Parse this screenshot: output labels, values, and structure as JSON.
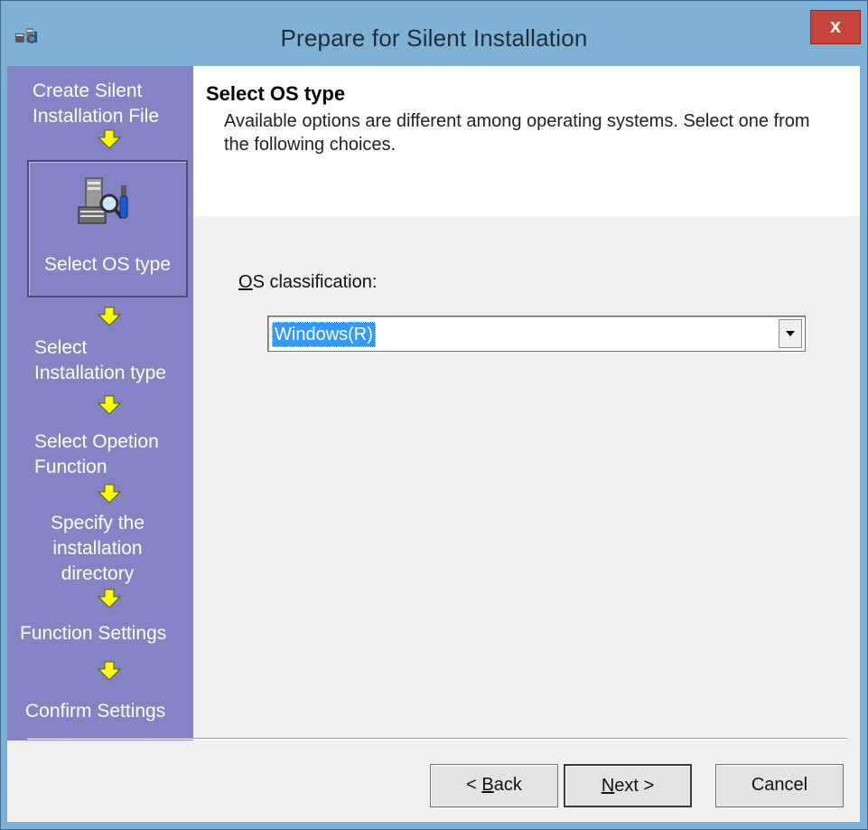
{
  "window": {
    "title": "Prepare for Silent Installation",
    "close_label": "x",
    "app_icon": "installer-icon"
  },
  "sidebar": {
    "steps": [
      {
        "label_lines": [
          "Create Silent",
          "Installation File"
        ],
        "state": "done"
      },
      {
        "label": "Select OS type",
        "state": "current",
        "icon": "server-inspect-icon"
      },
      {
        "label_lines": [
          "Select",
          "Installation type"
        ],
        "state": "pending"
      },
      {
        "label_lines": [
          "Select Opetion",
          "Function"
        ],
        "state": "pending"
      },
      {
        "label_lines": [
          "Specify the",
          "installation",
          "directory"
        ],
        "state": "pending"
      },
      {
        "label": "Function Settings",
        "state": "pending"
      },
      {
        "label": "Confirm Settings",
        "state": "pending"
      }
    ],
    "arrow_color": "#ffff00",
    "background_color": "#8483c6"
  },
  "header": {
    "title": "Select OS type",
    "description": "Available options are different among operating systems. Select one from the following choices."
  },
  "form": {
    "os_label_accel": "O",
    "os_label_rest": "S classification:",
    "os_value": "Windows(R)"
  },
  "buttons": {
    "back_accel": "B",
    "back_prefix": "< ",
    "back_rest": "ack",
    "next_accel": "N",
    "next_rest": "ext >",
    "cancel": "Cancel"
  }
}
